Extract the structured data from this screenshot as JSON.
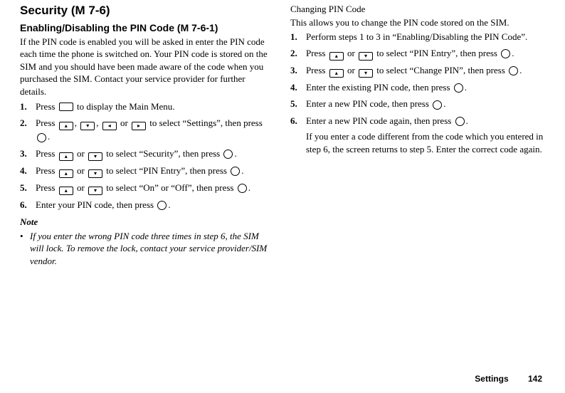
{
  "footer": {
    "section": "Settings",
    "page": "142"
  },
  "col1": {
    "title": "Security",
    "titleref": " (M 7-6)",
    "h2": "Enabling/Disabling the PIN Code",
    "h2ref": " (M 7-6-1)",
    "intro": "If the PIN code is enabled you will be asked in enter the PIN code each time the phone is switched on. Your PIN code is stored on the SIM and you should have been made aware of the code when you purchased the SIM. Contact your service provider for further details.",
    "steps": [
      {
        "n": "1.",
        "parts": [
          "Press ",
          {
            "icon": "rect"
          },
          " to display the Main Menu."
        ]
      },
      {
        "n": "2.",
        "parts": [
          "Press ",
          {
            "icon": "up"
          },
          ", ",
          {
            "icon": "down"
          },
          ", ",
          {
            "icon": "left"
          },
          " or ",
          {
            "icon": "right"
          },
          " to select “Settings”, then press ",
          {
            "icon": "round"
          },
          "."
        ]
      },
      {
        "n": "3.",
        "parts": [
          "Press ",
          {
            "icon": "up"
          },
          " or ",
          {
            "icon": "down"
          },
          " to select “Security”, then press ",
          {
            "icon": "round"
          },
          "."
        ]
      },
      {
        "n": "4.",
        "parts": [
          "Press ",
          {
            "icon": "up"
          },
          " or ",
          {
            "icon": "down"
          },
          " to select “PIN Entry”, then press ",
          {
            "icon": "round"
          },
          "."
        ]
      },
      {
        "n": "5.",
        "parts": [
          "Press ",
          {
            "icon": "up"
          },
          " or ",
          {
            "icon": "down"
          },
          " to select “On” or “Off”, then press ",
          {
            "icon": "round"
          },
          "."
        ]
      },
      {
        "n": "6.",
        "parts": [
          "Enter your PIN code, then press ",
          {
            "icon": "round"
          },
          "."
        ]
      }
    ],
    "noteTitle": "Note",
    "noteBullet": "•",
    "noteText": "If you enter the wrong PIN code three times in step 6, the SIM will lock. To remove the lock, contact your service provider/SIM vendor."
  },
  "col2": {
    "h3": "Changing PIN Code",
    "intro": "This allows you to change the PIN code stored on the SIM.",
    "steps": [
      {
        "n": "1.",
        "parts": [
          "Perform steps 1 to 3 in “Enabling/Disabling the PIN Code”."
        ]
      },
      {
        "n": "2.",
        "parts": [
          "Press ",
          {
            "icon": "up"
          },
          " or ",
          {
            "icon": "down"
          },
          " to select “PIN Entry”, then press ",
          {
            "icon": "round"
          },
          "."
        ]
      },
      {
        "n": "3.",
        "parts": [
          "Press ",
          {
            "icon": "up"
          },
          " or ",
          {
            "icon": "down"
          },
          " to select “Change PIN”, then press ",
          {
            "icon": "round"
          },
          "."
        ]
      },
      {
        "n": "4.",
        "parts": [
          "Enter the existing PIN code, then press ",
          {
            "icon": "round"
          },
          "."
        ]
      },
      {
        "n": "5.",
        "parts": [
          "Enter a new PIN code, then press ",
          {
            "icon": "round"
          },
          "."
        ]
      },
      {
        "n": "6.",
        "parts": [
          "Enter a new PIN code again, then press ",
          {
            "icon": "round"
          },
          ".",
          {
            "br": true
          },
          "If you enter a code different from the code which you entered in step 6, the screen returns to step 5. Enter the correct code again."
        ]
      }
    ]
  },
  "icons": {
    "rect": "",
    "round": "",
    "up": "▴",
    "down": "▾",
    "left": "◂",
    "right": "▸"
  }
}
